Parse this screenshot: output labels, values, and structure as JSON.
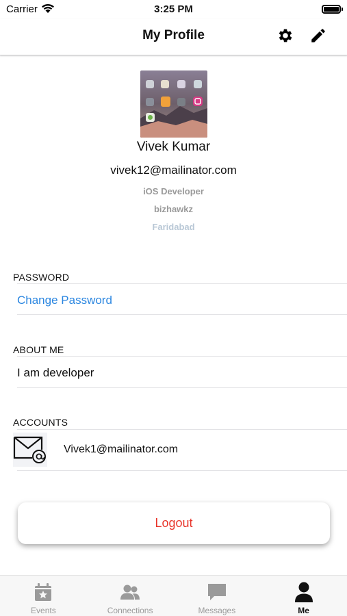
{
  "status_bar": {
    "carrier": "Carrier",
    "time": "3:25 PM"
  },
  "nav": {
    "title": "My Profile",
    "settings_icon": "gear-icon",
    "edit_icon": "pencil-icon"
  },
  "profile": {
    "name": "Vivek Kumar",
    "email": "vivek12@mailinator.com",
    "role": "iOS Developer",
    "company": "bizhawkz",
    "city": "Faridabad"
  },
  "sections": {
    "password": {
      "header": "PASSWORD",
      "action": "Change Password"
    },
    "about": {
      "header": "ABOUT ME",
      "text": "I am developer"
    },
    "accounts": {
      "header": "ACCOUNTS",
      "items": [
        {
          "icon": "mail-at-icon",
          "email": "Vivek1@mailinator.com"
        }
      ]
    }
  },
  "logout": {
    "label": "Logout"
  },
  "tabs": [
    {
      "label": "Events",
      "icon": "calendar-star-icon",
      "active": false
    },
    {
      "label": "Connections",
      "icon": "people-icon",
      "active": false
    },
    {
      "label": "Messages",
      "icon": "chat-bubble-icon",
      "active": false
    },
    {
      "label": "Me",
      "icon": "person-icon",
      "active": true
    }
  ],
  "colors": {
    "link": "#2b86e0",
    "logout": "#e8352b",
    "tab_inactive": "#9a9a9a",
    "tab_active": "#111111"
  }
}
